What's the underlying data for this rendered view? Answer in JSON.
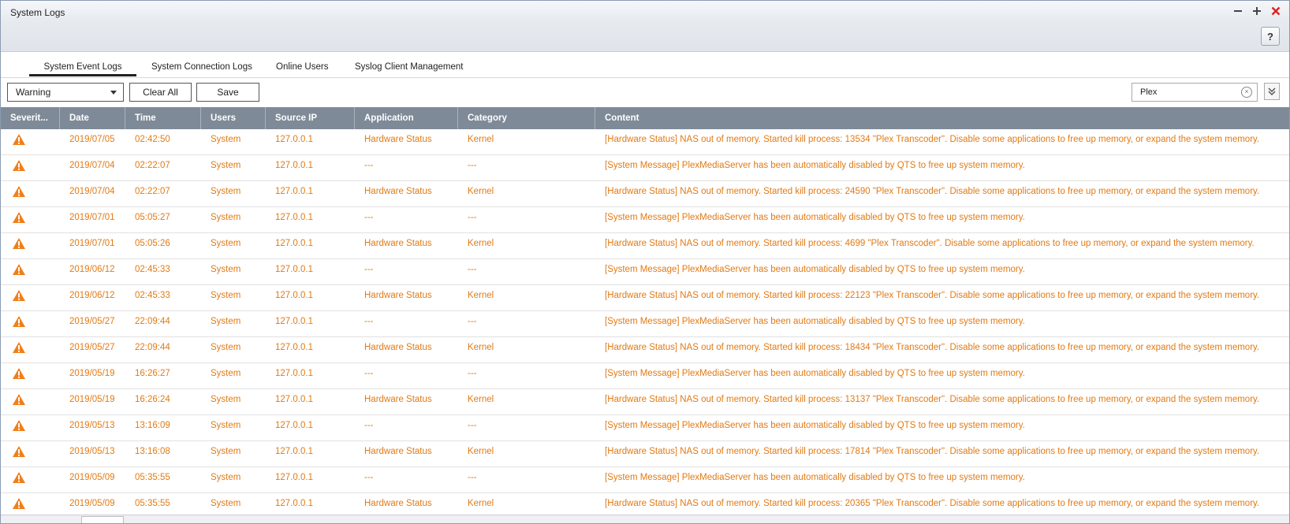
{
  "window": {
    "title": "System Logs",
    "help_label": "?"
  },
  "tabs": [
    "System Event Logs",
    "System Connection Logs",
    "Online Users",
    "Syslog Client Management"
  ],
  "toolbar": {
    "severity_filter": "Warning",
    "clear_all_label": "Clear All",
    "save_label": "Save",
    "search_value": "Plex"
  },
  "columns": [
    "Severit...",
    "Date",
    "Time",
    "Users",
    "Source IP",
    "Application",
    "Category",
    "Content"
  ],
  "rows": [
    {
      "date": "2019/07/05",
      "time": "02:42:50",
      "user": "System",
      "ip": "127.0.0.1",
      "app": "Hardware Status",
      "cat": "Kernel",
      "content": "[Hardware Status] NAS out of memory. Started kill process: 13534 \"Plex Transcoder\". Disable some applications to free up memory, or expand the system memory."
    },
    {
      "date": "2019/07/04",
      "time": "02:22:07",
      "user": "System",
      "ip": "127.0.0.1",
      "app": "---",
      "cat": "---",
      "content": "[System Message] PlexMediaServer has been automatically disabled by QTS to free up system memory."
    },
    {
      "date": "2019/07/04",
      "time": "02:22:07",
      "user": "System",
      "ip": "127.0.0.1",
      "app": "Hardware Status",
      "cat": "Kernel",
      "content": "[Hardware Status] NAS out of memory. Started kill process: 24590 \"Plex Transcoder\". Disable some applications to free up memory, or expand the system memory."
    },
    {
      "date": "2019/07/01",
      "time": "05:05:27",
      "user": "System",
      "ip": "127.0.0.1",
      "app": "---",
      "cat": "---",
      "content": "[System Message] PlexMediaServer has been automatically disabled by QTS to free up system memory."
    },
    {
      "date": "2019/07/01",
      "time": "05:05:26",
      "user": "System",
      "ip": "127.0.0.1",
      "app": "Hardware Status",
      "cat": "Kernel",
      "content": "[Hardware Status] NAS out of memory. Started kill process: 4699 \"Plex Transcoder\". Disable some applications to free up memory, or expand the system memory."
    },
    {
      "date": "2019/06/12",
      "time": "02:45:33",
      "user": "System",
      "ip": "127.0.0.1",
      "app": "---",
      "cat": "---",
      "content": "[System Message] PlexMediaServer has been automatically disabled by QTS to free up system memory."
    },
    {
      "date": "2019/06/12",
      "time": "02:45:33",
      "user": "System",
      "ip": "127.0.0.1",
      "app": "Hardware Status",
      "cat": "Kernel",
      "content": "[Hardware Status] NAS out of memory. Started kill process: 22123 \"Plex Transcoder\". Disable some applications to free up memory, or expand the system memory."
    },
    {
      "date": "2019/05/27",
      "time": "22:09:44",
      "user": "System",
      "ip": "127.0.0.1",
      "app": "---",
      "cat": "---",
      "content": "[System Message] PlexMediaServer has been automatically disabled by QTS to free up system memory."
    },
    {
      "date": "2019/05/27",
      "time": "22:09:44",
      "user": "System",
      "ip": "127.0.0.1",
      "app": "Hardware Status",
      "cat": "Kernel",
      "content": "[Hardware Status] NAS out of memory. Started kill process: 18434 \"Plex Transcoder\". Disable some applications to free up memory, or expand the system memory."
    },
    {
      "date": "2019/05/19",
      "time": "16:26:27",
      "user": "System",
      "ip": "127.0.0.1",
      "app": "---",
      "cat": "---",
      "content": "[System Message] PlexMediaServer has been automatically disabled by QTS to free up system memory."
    },
    {
      "date": "2019/05/19",
      "time": "16:26:24",
      "user": "System",
      "ip": "127.0.0.1",
      "app": "Hardware Status",
      "cat": "Kernel",
      "content": "[Hardware Status] NAS out of memory. Started kill process: 13137 \"Plex Transcoder\". Disable some applications to free up memory, or expand the system memory."
    },
    {
      "date": "2019/05/13",
      "time": "13:16:09",
      "user": "System",
      "ip": "127.0.0.1",
      "app": "---",
      "cat": "---",
      "content": "[System Message] PlexMediaServer has been automatically disabled by QTS to free up system memory."
    },
    {
      "date": "2019/05/13",
      "time": "13:16:08",
      "user": "System",
      "ip": "127.0.0.1",
      "app": "Hardware Status",
      "cat": "Kernel",
      "content": "[Hardware Status] NAS out of memory. Started kill process: 17814 \"Plex Transcoder\". Disable some applications to free up memory, or expand the system memory."
    },
    {
      "date": "2019/05/09",
      "time": "05:35:55",
      "user": "System",
      "ip": "127.0.0.1",
      "app": "---",
      "cat": "---",
      "content": "[System Message] PlexMediaServer has been automatically disabled by QTS to free up system memory."
    },
    {
      "date": "2019/05/09",
      "time": "05:35:55",
      "user": "System",
      "ip": "127.0.0.1",
      "app": "Hardware Status",
      "cat": "Kernel",
      "content": "[Hardware Status] NAS out of memory. Started kill process: 20365 \"Plex Transcoder\". Disable some applications to free up memory, or expand the system memory."
    }
  ],
  "colors": {
    "log_text": "#e27a14",
    "header_bg": "#7f8a98",
    "warning_icon": "#f07f1a"
  },
  "icons": {
    "severity": "warning-icon",
    "minimize": "minimize-icon",
    "maximize": "maximize-icon",
    "close": "close-icon"
  }
}
